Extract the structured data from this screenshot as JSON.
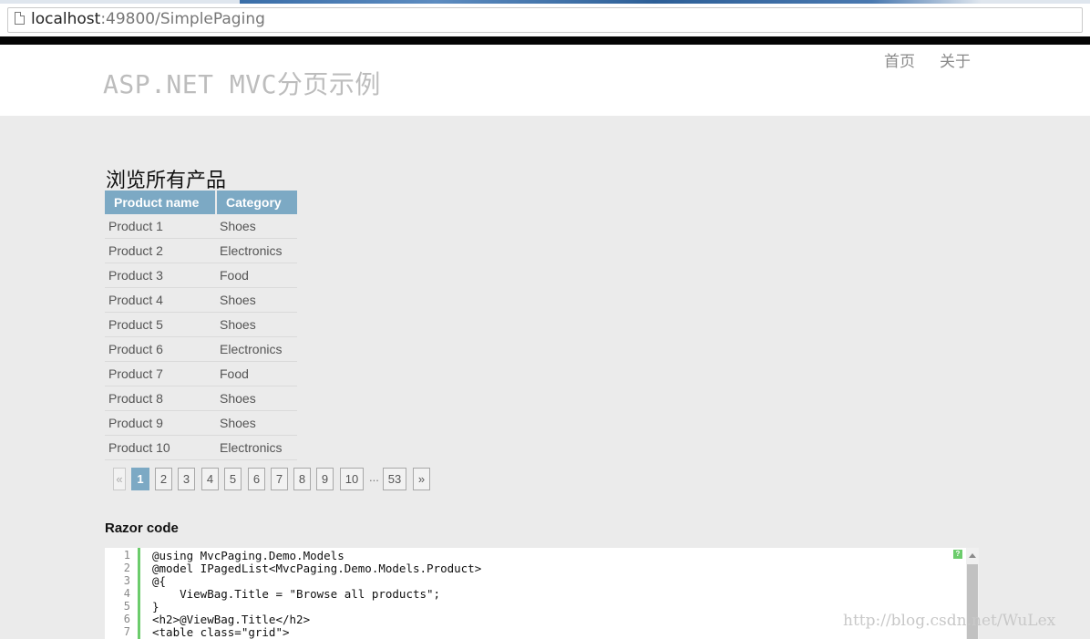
{
  "browser": {
    "url_host": "localhost",
    "url_rest": ":49800/SimplePaging"
  },
  "header": {
    "site_title": "ASP.NET MVC分页示例",
    "nav": [
      "首页",
      "关于"
    ]
  },
  "main": {
    "heading": "浏览所有产品",
    "table": {
      "columns": [
        "Product name",
        "Category"
      ],
      "rows": [
        [
          "Product 1",
          "Shoes"
        ],
        [
          "Product 2",
          "Electronics"
        ],
        [
          "Product 3",
          "Food"
        ],
        [
          "Product 4",
          "Shoes"
        ],
        [
          "Product 5",
          "Shoes"
        ],
        [
          "Product 6",
          "Electronics"
        ],
        [
          "Product 7",
          "Food"
        ],
        [
          "Product 8",
          "Shoes"
        ],
        [
          "Product 9",
          "Shoes"
        ],
        [
          "Product 10",
          "Electronics"
        ]
      ]
    },
    "pager": {
      "prev": "«",
      "pages": [
        "1",
        "2",
        "3",
        "4",
        "5",
        "6",
        "7",
        "8",
        "9",
        "10"
      ],
      "current": "1",
      "ellipsis": "...",
      "last": "53",
      "next": "»"
    }
  },
  "razor": {
    "title": "Razor code",
    "expand_label": "?",
    "lines": [
      {
        "n": "1",
        "t": "@using MvcPaging.Demo.Models"
      },
      {
        "n": "2",
        "t": "@model IPagedList<MvcPaging.Demo.Models.Product>"
      },
      {
        "n": "3",
        "t": "@{"
      },
      {
        "n": "4",
        "t": "    ViewBag.Title = \"Browse all products\";"
      },
      {
        "n": "5",
        "t": "}"
      },
      {
        "n": "6",
        "t": "<h2>@ViewBag.Title</h2>"
      },
      {
        "n": "7",
        "t": "<table class=\"grid\">"
      }
    ]
  },
  "watermark": "http://blog.csdn.net/WuLex",
  "colors": {
    "table_header_bg": "#7ca9c4",
    "page_bg": "#ebebeb",
    "code_gutter_line": "#6ccc6c"
  }
}
